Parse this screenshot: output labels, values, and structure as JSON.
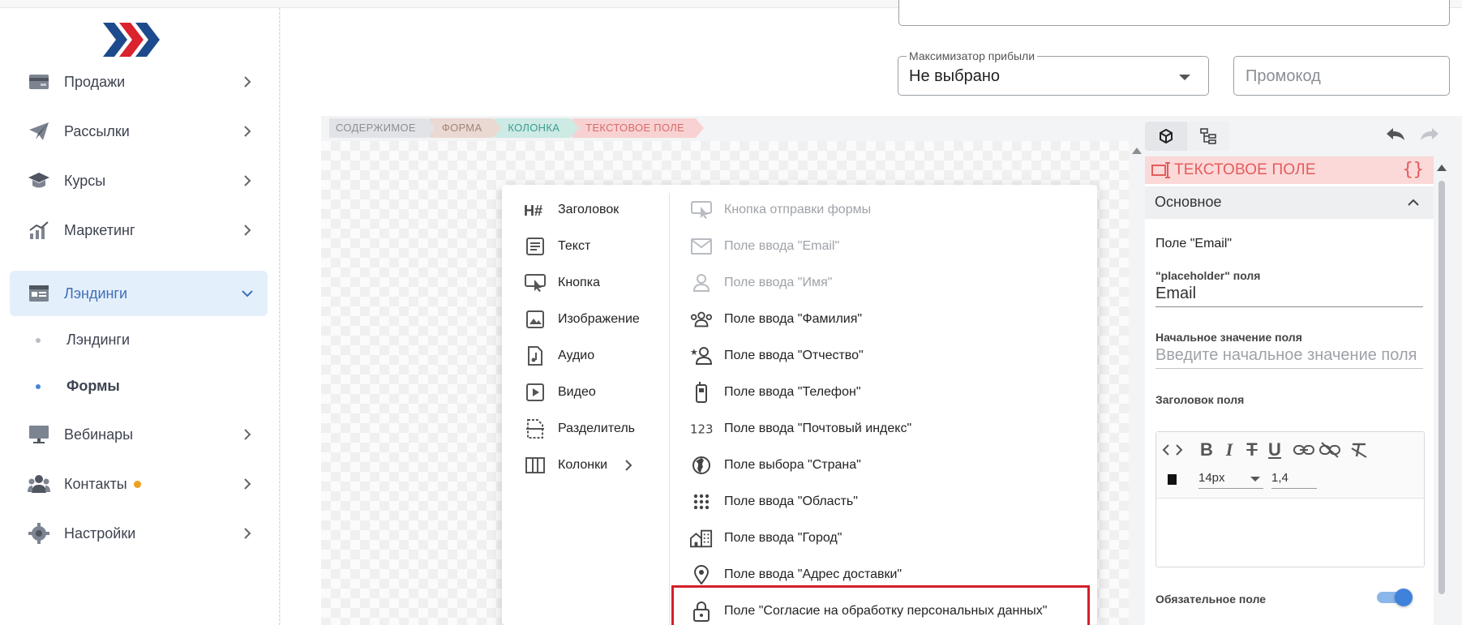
{
  "sidebar": {
    "items": [
      {
        "label": "Продажи",
        "icon": "wallet-icon"
      },
      {
        "label": "Рассылки",
        "icon": "paper-plane-icon"
      },
      {
        "label": "Курсы",
        "icon": "graduation-cap-icon"
      },
      {
        "label": "Маркетинг",
        "icon": "chart-growth-icon"
      },
      {
        "label": "Лэндинги",
        "icon": "landing-page-icon",
        "active": true
      },
      {
        "label": "Вебинары",
        "icon": "monitor-icon"
      },
      {
        "label": "Контакты",
        "icon": "contacts-icon",
        "badge_color": "#f0a020"
      },
      {
        "label": "Настройки",
        "icon": "gear-icon"
      }
    ],
    "subitems": [
      {
        "label": "Лэндинги"
      },
      {
        "label": "Формы",
        "active": true
      }
    ]
  },
  "form_settings": {
    "maximizer_label": "Максимизатор прибыли",
    "maximizer_value": "Не выбрано",
    "promo_placeholder": "Промокод"
  },
  "breadcrumbs": [
    "Содержимое",
    "Форма",
    "Колонка",
    "Текстовое поле"
  ],
  "menu": {
    "left": [
      {
        "label": "Заголовок",
        "icon": "heading-icon"
      },
      {
        "label": "Текст",
        "icon": "text-icon"
      },
      {
        "label": "Кнопка",
        "icon": "button-click-icon"
      },
      {
        "label": "Изображение",
        "icon": "image-icon"
      },
      {
        "label": "Аудио",
        "icon": "audio-icon"
      },
      {
        "label": "Видео",
        "icon": "video-icon"
      },
      {
        "label": "Разделитель",
        "icon": "divider-icon"
      },
      {
        "label": "Колонки",
        "icon": "columns-icon"
      }
    ],
    "right": [
      {
        "label": "Кнопка отправки формы",
        "icon": "submit-button-icon",
        "disabled": true
      },
      {
        "label": "Поле ввода \"Email\"",
        "icon": "email-icon",
        "disabled": true
      },
      {
        "label": "Поле ввода \"Имя\"",
        "icon": "person-icon",
        "disabled": true
      },
      {
        "label": "Поле ввода \"Фамилия\"",
        "icon": "people-icon"
      },
      {
        "label": "Поле ввода \"Отчество\"",
        "icon": "person-star-icon"
      },
      {
        "label": "Поле ввода \"Телефон\"",
        "icon": "phone-icon"
      },
      {
        "label": "Поле ввода \"Почтовый индекс\"",
        "icon": "number-123-icon"
      },
      {
        "label": "Поле выбора \"Страна\"",
        "icon": "globe-icon"
      },
      {
        "label": "Поле ввода \"Область\"",
        "icon": "dots-grid-icon"
      },
      {
        "label": "Поле ввода \"Город\"",
        "icon": "city-icon"
      },
      {
        "label": "Поле ввода \"Адрес доставки\"",
        "icon": "location-pin-icon"
      },
      {
        "label": "Поле \"Согласие на обработку персональных данных\"",
        "icon": "lock-icon"
      }
    ]
  },
  "panel": {
    "header": "Текстовое поле",
    "section": "Основное",
    "field_name": "Поле \"Email\"",
    "placeholder_label": "\"placeholder\" поля",
    "placeholder_value": "Email",
    "initial_label": "Начальное значение поля",
    "initial_placeholder": "Введите начальное значение поля",
    "heading_label": "Заголовок поля",
    "font_size": "14px",
    "line_height": "1,4",
    "required_label": "Обязательное поле",
    "required_on": true
  },
  "colors": {
    "accent": "#3f82dc",
    "header_red": "#e45b5b",
    "highlight": "#d32029"
  }
}
